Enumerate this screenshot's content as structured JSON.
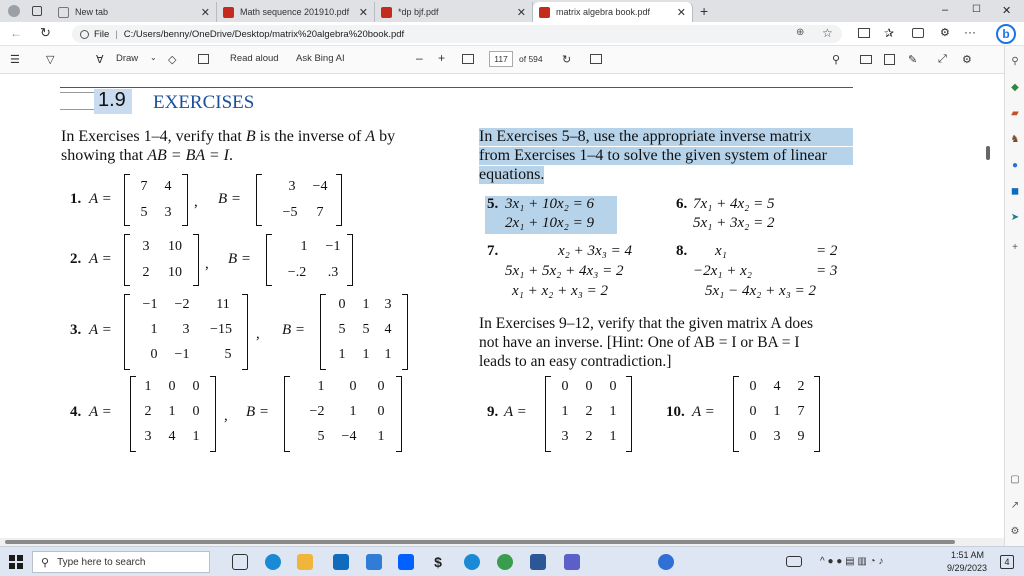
{
  "browser": {
    "tabs": [
      {
        "title": "New tab",
        "icon": "new-tab-icon",
        "active": false
      },
      {
        "title": "Math sequence 201910.pdf",
        "icon": "pdf-icon",
        "active": false
      },
      {
        "title": "*dp bjf.pdf",
        "icon": "pdf-icon",
        "active": false
      },
      {
        "title": "matrix algebra book.pdf",
        "icon": "pdf-icon",
        "active": true
      }
    ],
    "new_tab_symbol": "+",
    "window_controls": [
      "–",
      "☐",
      "✕"
    ],
    "address": {
      "scheme_label": "File",
      "separator": "|",
      "url": "C:/Users/benny/OneDrive/Desktop/matrix%20algebra%20book.pdf"
    }
  },
  "pdf_toolbar": {
    "draw_label": "Draw",
    "read_aloud_label": "Read aloud",
    "ask_bing_label": "Ask Bing AI",
    "zoom_out": "–",
    "zoom_in": "+",
    "page_number": "117",
    "page_total": "of 594"
  },
  "document": {
    "section_number": "1.9",
    "section_title": "EXERCISES",
    "left_intro_1": "In Exercises 1–4, verify that ",
    "left_intro_B": "B",
    "left_intro_2": " is the inverse of ",
    "left_intro_A": "A",
    "left_intro_3": " by",
    "left_intro_line2_a": "showing that ",
    "left_intro_line2_eq": "AB = BA = I",
    "left_intro_line2_end": ".",
    "ex1_label": "1.",
    "ex2_label": "2.",
    "ex3_label": "3.",
    "ex4_label": "4.",
    "A_eq": "A =",
    "B_eq": "B =",
    "comma": ",",
    "ex1_A": [
      [
        "7",
        "4"
      ],
      [
        "5",
        "3"
      ]
    ],
    "ex1_B": [
      [
        "3",
        "−4"
      ],
      [
        "−5",
        "7"
      ]
    ],
    "ex2_A": [
      [
        "3",
        "10"
      ],
      [
        "2",
        "10"
      ]
    ],
    "ex2_B": [
      [
        "1",
        "−1"
      ],
      [
        "−.2",
        ".3"
      ]
    ],
    "ex3_A": [
      [
        "−1",
        "−2",
        "11"
      ],
      [
        "1",
        "3",
        "−15"
      ],
      [
        "0",
        "−1",
        "5"
      ]
    ],
    "ex3_B": [
      [
        "0",
        "1",
        "3"
      ],
      [
        "5",
        "5",
        "4"
      ],
      [
        "1",
        "1",
        "1"
      ]
    ],
    "ex4_A": [
      [
        "1",
        "0",
        "0"
      ],
      [
        "2",
        "1",
        "0"
      ],
      [
        "3",
        "4",
        "1"
      ]
    ],
    "ex4_B": [
      [
        "1",
        "0",
        "0"
      ],
      [
        "−2",
        "1",
        "0"
      ],
      [
        "5",
        "−4",
        "1"
      ]
    ],
    "right_intro_1": "In Exercises 5–8, use the appropriate inverse matrix",
    "right_intro_2": "from Exercises 1–4 to solve the given system of linear",
    "right_intro_3": "equations.",
    "ex5_label": "5.",
    "ex5_l1": "3x₁ + 10x₂ = 6",
    "ex5_l2": "2x₁ + 10x₂ = 9",
    "ex6_label": "6.",
    "ex6_l1": "7x₁ + 4x₂ = 5",
    "ex6_l2": "5x₁ + 3x₂ = 2",
    "ex7_label": "7.",
    "ex7_l1": "x₂ + 3x₃ = 4",
    "ex7_l2": "5x₁ + 5x₂ + 4x₃ = 2",
    "ex7_l3": "x₁ +  x₂ +  x₃ = 2",
    "ex8_label": "8.",
    "ex8_l1a": "x₁",
    "ex8_l1b": "= 2",
    "ex8_l2a": "−2x₁ +  x₂",
    "ex8_l2b": "= 3",
    "ex8_l3": "5x₁ − 4x₂ + x₃ = 2",
    "contra_1": "In Exercises 9–12, verify that the given matrix A does",
    "contra_2": "not have an inverse. [Hint: One of AB = I or BA = I",
    "contra_3": "leads to an easy contradiction.]",
    "ex9_label": "9.",
    "ex10_label": "10.",
    "ex9_A": [
      [
        "0",
        "0",
        "0"
      ],
      [
        "1",
        "2",
        "1"
      ],
      [
        "3",
        "2",
        "1"
      ]
    ],
    "ex10_A": [
      [
        "0",
        "4",
        "2"
      ],
      [
        "0",
        "1",
        "7"
      ],
      [
        "0",
        "3",
        "9"
      ]
    ]
  },
  "taskbar": {
    "search_placeholder": "Type here to search",
    "time": "1:51 AM",
    "date": "9/29/2023",
    "notification_count": "4"
  },
  "colors": {
    "highlight": "#b6d3ea",
    "accent": "#0f6cbd",
    "section_blue": "#1a4f9c"
  }
}
